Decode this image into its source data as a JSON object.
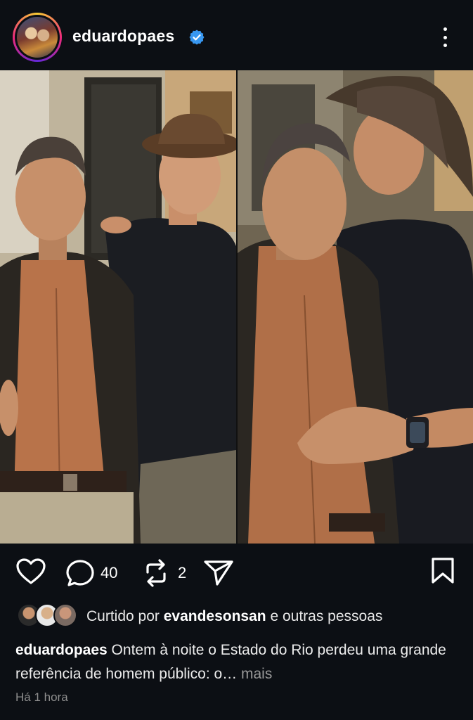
{
  "post": {
    "username": "eduardopaes",
    "liked_by_prefix": "Curtido por ",
    "liked_by_user": "evandesonsan",
    "liked_by_suffix": " e outras pessoas",
    "caption_text": " Ontem à noite o Estado do Rio perdeu uma grande referência de homem público: o…",
    "caption_more": " mais",
    "timestamp": "Há 1 hora"
  },
  "actions": {
    "comments_count": "40",
    "reposts_count": "2"
  },
  "icons": {
    "more": "more-vertical-icon",
    "like": "heart-icon",
    "comment": "comment-icon",
    "repost": "repost-icon",
    "share": "send-icon",
    "save": "bookmark-icon",
    "verified": "verified-badge-icon"
  },
  "colors": {
    "background": "#0c0f14",
    "verified_blue": "#3897f0",
    "text_secondary": "#8e8e8e"
  }
}
